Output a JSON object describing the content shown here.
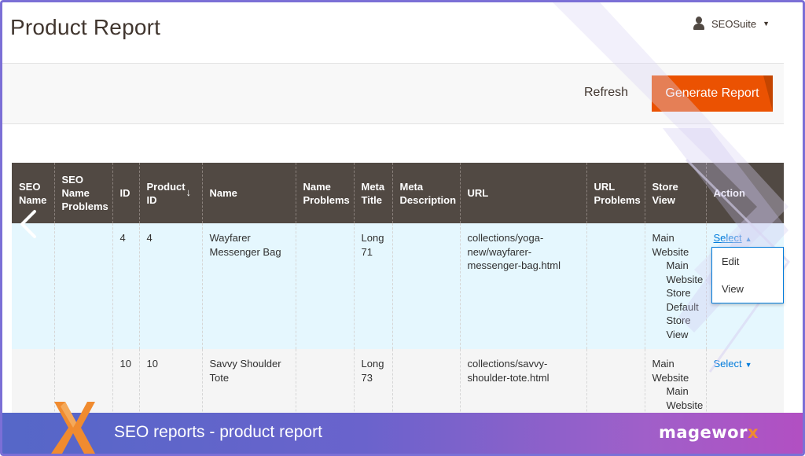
{
  "header": {
    "title": "Product Report",
    "account_name": "SEOSuite"
  },
  "toolbar": {
    "refresh_label": "Refresh",
    "generate_label": "Generate Report"
  },
  "grid": {
    "columns": [
      {
        "label": "SEO Name"
      },
      {
        "label": "SEO Name Problems"
      },
      {
        "label": "ID"
      },
      {
        "label": "Product ID",
        "sort": "↓"
      },
      {
        "label": "Name"
      },
      {
        "label": "Name Problems"
      },
      {
        "label": "Meta Title"
      },
      {
        "label": "Meta Description"
      },
      {
        "label": "URL"
      },
      {
        "label": "URL Problems"
      },
      {
        "label": "Store View"
      },
      {
        "label": "Action"
      }
    ],
    "rows": [
      {
        "seo_name": "",
        "seo_name_problems": "",
        "id": "4",
        "product_id": "4",
        "name": "Wayfarer Messenger Bag",
        "name_problems": "",
        "meta_title": "Long 71",
        "meta_description": "",
        "url": "collections/yoga-new/wayfarer-messenger-bag.html",
        "url_problems": "",
        "store_view": [
          "Main Website",
          "Main Website Store",
          "Default Store View"
        ],
        "action": "Select"
      },
      {
        "seo_name": "",
        "seo_name_problems": "",
        "id": "10",
        "product_id": "10",
        "name": "Savvy Shoulder Tote",
        "name_problems": "",
        "meta_title": "Long 73",
        "meta_description": "",
        "url": "collections/savvy-shoulder-tote.html",
        "url_problems": "",
        "store_view": [
          "Main Website",
          "Main Website Store"
        ],
        "action": "Select"
      }
    ],
    "action_menu": [
      "Edit",
      "View"
    ]
  },
  "footer": {
    "caption": "SEO reports - product report",
    "brand_prefix": "magewor",
    "brand_x": "x"
  },
  "colors": {
    "accent": "#eb5202",
    "header_bg": "#514943",
    "link": "#007bdb",
    "highlight_row": "#e5f7fe",
    "banner_start": "#5567c8",
    "banner_end": "#b24fc2"
  },
  "icons": [
    "user-icon",
    "chevron-down-icon",
    "chevron-up-icon",
    "chevron-left-icon",
    "mageworx-x-logo"
  ]
}
